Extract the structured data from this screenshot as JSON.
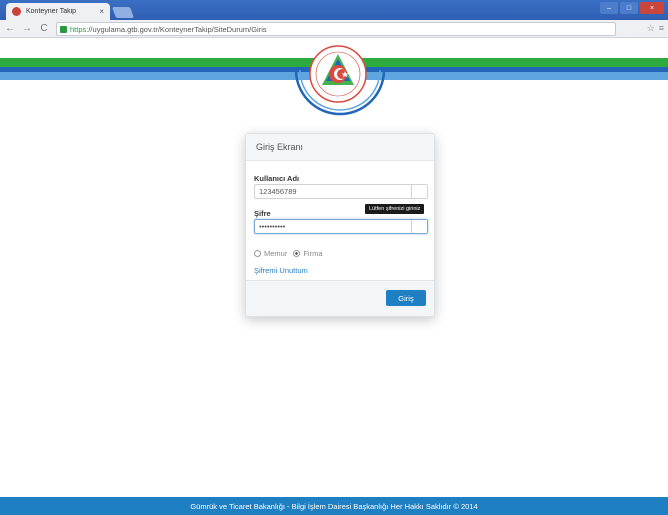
{
  "browser": {
    "tab_title": "Konteyner Takip",
    "tab_close": "×",
    "window_controls": [
      "–",
      "□",
      "×"
    ],
    "nav": {
      "back": "←",
      "forward": "→",
      "reload": "C"
    },
    "url_scheme": "https",
    "url_rest": "://uygulama.gtb.gov.tr/KonteynerTakip/SiteDurum/Giris",
    "toolbar_icons": [
      "☆",
      "≡"
    ]
  },
  "login": {
    "heading": "Giriş Ekranı",
    "username_label": "Kullanıcı Adı",
    "username_value": "123456789",
    "password_label": "Şifre",
    "password_value": "••••••••••",
    "tooltip": "Lütfen şifrenizi giriniz",
    "radio_options": [
      {
        "label": "Memur",
        "checked": false
      },
      {
        "label": "Firma",
        "checked": true
      }
    ],
    "forgot_link": "Şifremi Unuttum",
    "submit_label": "Giriş"
  },
  "footer": {
    "text": "Gümrük ve Ticaret Bakanlığı - Bilgi İşlem Dairesi Başkanlığı Her Hakkı Saklıdır © 2014"
  },
  "colors": {
    "brand_blue": "#1f7fc3",
    "band_green": "#2faa3e",
    "band_dark_blue": "#2166b8",
    "band_light_blue": "#5fa5e0"
  },
  "icons": {
    "logo": "ministry-emblem-icon"
  }
}
